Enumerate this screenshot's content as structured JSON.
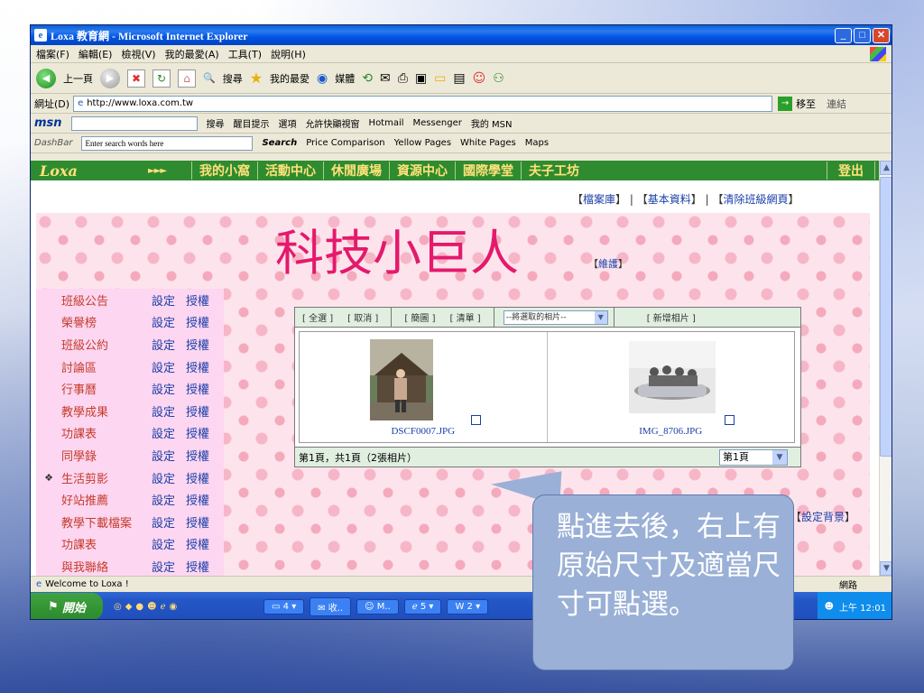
{
  "window": {
    "title": "Loxa 教育網 - Microsoft Internet Explorer"
  },
  "menu": [
    "檔案(F)",
    "編輯(E)",
    "檢視(V)",
    "我的最愛(A)",
    "工具(T)",
    "說明(H)"
  ],
  "toolbar": {
    "back": "上一頁",
    "search": "搜尋",
    "favorites": "我的最愛",
    "media": "媒體"
  },
  "address": {
    "label": "網址(D)",
    "url": "http://www.loxa.com.tw",
    "go": "移至",
    "links": "連結"
  },
  "msn": {
    "logo": "msn",
    "search": "搜尋",
    "highlight": "醒目提示",
    "options": "選項",
    "popup": "允許快顯視窗",
    "hotmail": "Hotmail",
    "messenger": "Messenger",
    "my_msn": "我的 MSN"
  },
  "dashbar": {
    "logo": "DashBar",
    "placeholder": "Enter search words here",
    "search": "Search",
    "price": "Price Comparison",
    "yellow": "Yellow Pages",
    "white": "White Pages",
    "maps": "Maps"
  },
  "site_nav": {
    "logo": "Loxa",
    "arrows": "►►►",
    "items": [
      "我的小窩",
      "活動中心",
      "休閒廣場",
      "資源中心",
      "國際學堂",
      "夫子工坊"
    ],
    "logout": "登出"
  },
  "top_links": {
    "archive": "檔案庫",
    "basic": "基本資料",
    "clear": "清除班級網頁",
    "sep": "|"
  },
  "banner": {
    "title": "科技小巨人",
    "maintain": "維護"
  },
  "side_menu": [
    {
      "bullet": "",
      "label": "班級公告",
      "set": "設定",
      "auth": "授權"
    },
    {
      "bullet": "",
      "label": "榮譽榜",
      "set": "設定",
      "auth": "授權"
    },
    {
      "bullet": "",
      "label": "班級公約",
      "set": "設定",
      "auth": "授權"
    },
    {
      "bullet": "",
      "label": "討論區",
      "set": "設定",
      "auth": "授權"
    },
    {
      "bullet": "",
      "label": "行事曆",
      "set": "設定",
      "auth": "授權"
    },
    {
      "bullet": "",
      "label": "教學成果",
      "set": "設定",
      "auth": "授權"
    },
    {
      "bullet": "",
      "label": "功課表",
      "set": "設定",
      "auth": "授權"
    },
    {
      "bullet": "",
      "label": "同學錄",
      "set": "設定",
      "auth": "授權"
    },
    {
      "bullet": "❖",
      "label": "生活剪影",
      "set": "設定",
      "auth": "授權"
    },
    {
      "bullet": "",
      "label": "好站推薦",
      "set": "設定",
      "auth": "授權"
    },
    {
      "bullet": "",
      "label": "教學下載檔案",
      "set": "設定",
      "auth": "授權"
    },
    {
      "bullet": "",
      "label": "功課表",
      "set": "設定",
      "auth": "授權"
    },
    {
      "bullet": "",
      "label": "與我聯絡",
      "set": "設定",
      "auth": "授權"
    }
  ],
  "gallery": {
    "select_all": "[ 全選 ]",
    "cancel": "[ 取消 ]",
    "simple": "[ 簡圖 ]",
    "list": "[ 清單 ]",
    "select_placeholder": "--將選取的相片--",
    "add_photo": "[ 新增相片 ]",
    "photos": [
      {
        "name": "DSCF0007.JPG"
      },
      {
        "name": "IMG_8706.JPG"
      }
    ],
    "footer": "第1頁，共1頁（2張相片）",
    "page_select": "第1頁"
  },
  "set_bg": "設定背景",
  "status": {
    "left": "Welcome to Loxa !",
    "right": "網路"
  },
  "taskbar": {
    "start": "開始",
    "items": [
      "4",
      "收..",
      "M..",
      "5",
      "2"
    ],
    "clock": "上午 12:01"
  },
  "callout": {
    "text": "點進去後，右上有原始尺寸及適當尺寸可點選。"
  }
}
